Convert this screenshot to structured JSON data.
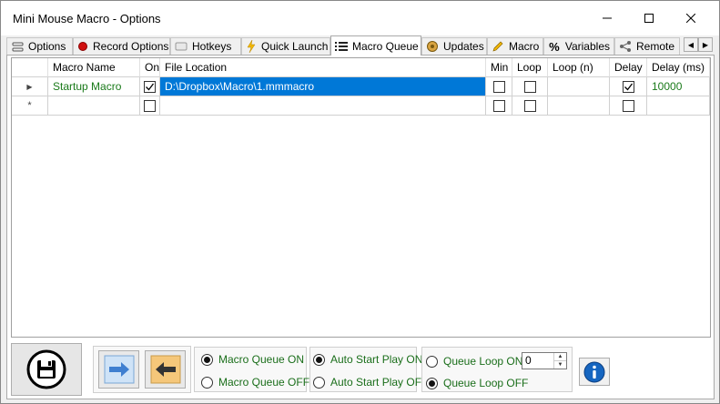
{
  "window": {
    "title": "Mini Mouse Macro - Options"
  },
  "tabs": [
    {
      "label": "Options",
      "icon": "options-icon"
    },
    {
      "label": "Record Options",
      "icon": "record-dot-icon"
    },
    {
      "label": "Hotkeys",
      "icon": "keyboard-icon"
    },
    {
      "label": "Quick Launch",
      "icon": "lightning-icon"
    },
    {
      "label": "Macro Queue",
      "icon": "list-icon",
      "active": true
    },
    {
      "label": "Updates",
      "icon": "updates-icon"
    },
    {
      "label": "Macro",
      "icon": "pencil-icon"
    },
    {
      "label": "Variables",
      "icon": "percent-icon"
    },
    {
      "label": "Remote",
      "icon": "share-icon"
    }
  ],
  "grid": {
    "columns": [
      "Macro Name",
      "On",
      "File Location",
      "Min",
      "Loop",
      "Loop (n)",
      "Delay",
      "Delay (ms)"
    ],
    "rows": [
      {
        "row_marker": "▶",
        "macro_name": "Startup Macro",
        "on": true,
        "file_location": "D:\\Dropbox\\Macro\\1.mmmacro",
        "min": false,
        "loop": false,
        "loop_n": "",
        "delay": true,
        "delay_ms": "10000"
      },
      {
        "row_marker": "*",
        "macro_name": "",
        "on": false,
        "file_location": "",
        "min": false,
        "loop": false,
        "loop_n": "",
        "delay": false,
        "delay_ms": ""
      }
    ]
  },
  "controls": {
    "macro_queue_on": "Macro Queue ON",
    "macro_queue_off": "Macro Queue OFF",
    "auto_start_on": "Auto Start Play ON",
    "auto_start_off": "Auto Start Play OFF",
    "queue_loop_on": "Queue Loop ON",
    "queue_loop_off": "Queue Loop OFF",
    "queue_loop_count": "0",
    "selected": {
      "macro_queue": "on",
      "auto_start": "on",
      "queue_loop": "off"
    }
  },
  "colors": {
    "selection": "#0078d7",
    "green_text": "#1a7a1a",
    "info_blue": "#1565c0",
    "arrow_blue": "#3f7fd0",
    "arrow_tan": "#f5c77a"
  }
}
